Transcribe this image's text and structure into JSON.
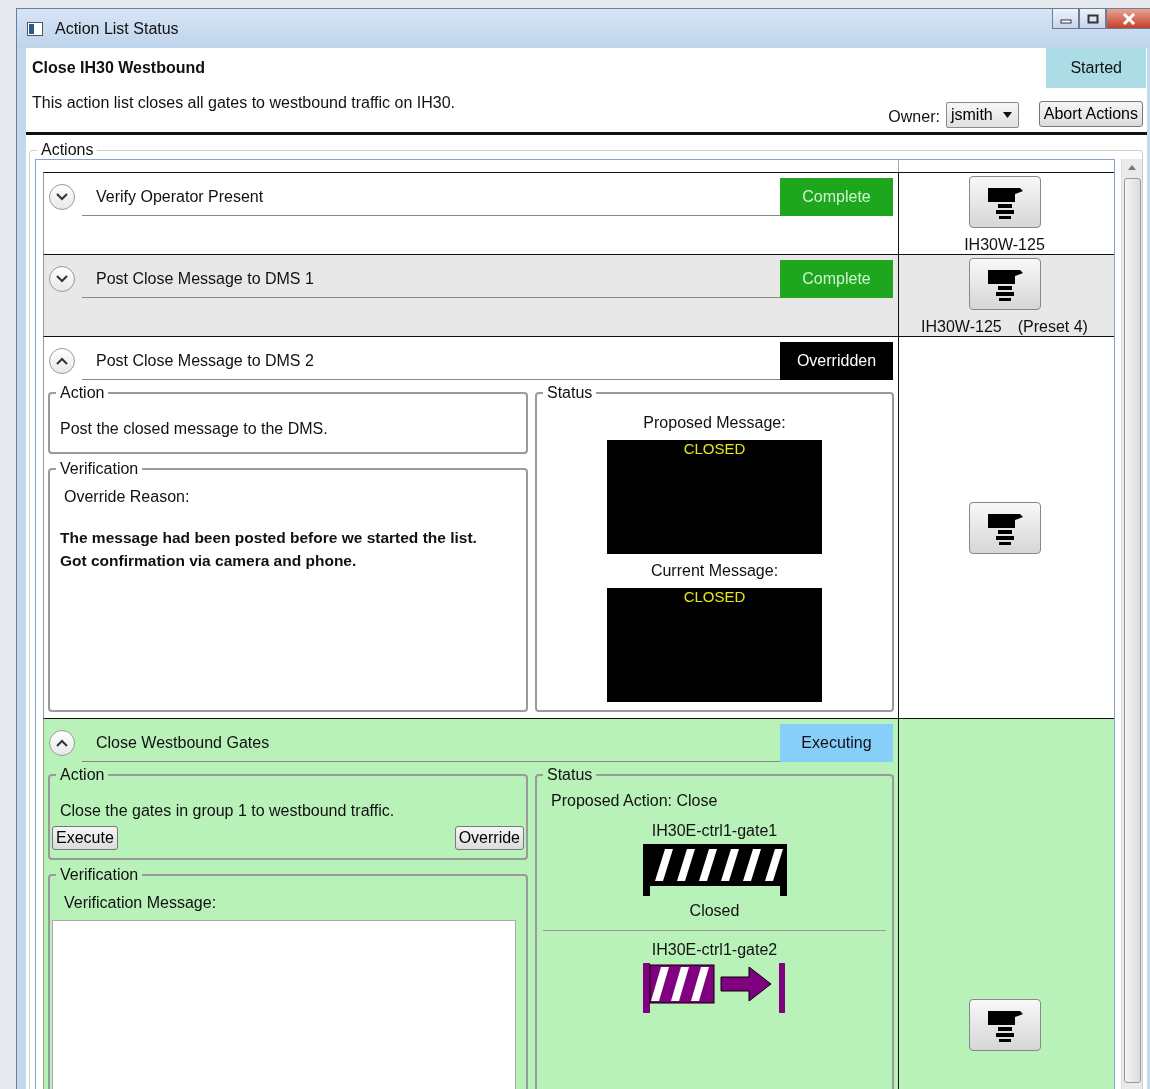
{
  "window": {
    "title": "Action List Status"
  },
  "header": {
    "title": "Close IH30 Westbound",
    "description": "This action list closes all gates to westbound traffic on IH30.",
    "status": "Started",
    "owner_label": "Owner:",
    "owner": "jsmith",
    "abort_button": "Abort Actions"
  },
  "actions_group": {
    "legend": "Actions"
  },
  "actions": [
    {
      "title": "Verify Operator Present",
      "expanded": false,
      "color": "#ffffff",
      "status": {
        "text": "Complete",
        "kind": "complete"
      },
      "camera": {
        "label": "IH30W-125"
      }
    },
    {
      "title": "Post Close Message to DMS 1",
      "expanded": false,
      "color": "#e8e8e8",
      "status": {
        "text": "Complete",
        "kind": "complete"
      },
      "camera": {
        "label": "IH30W-125",
        "preset": "(Preset 4)"
      }
    },
    {
      "title": "Post Close Message to DMS 2",
      "expanded": true,
      "color": "#ffffff",
      "status": {
        "text": "Overridden",
        "kind": "overridden"
      },
      "details": {
        "action": {
          "legend": "Action",
          "text": "Post the closed message to the DMS."
        },
        "verification": {
          "kind": "override_reason",
          "legend": "Verification",
          "label": "Override Reason:",
          "reason": "The message had been posted before we started the list.\nGot confirmation via camera and phone."
        },
        "status": {
          "kind": "dms",
          "legend": "Status",
          "messages": [
            {
              "label": "Proposed Message:",
              "text": "CLOSED"
            },
            {
              "label": "Current Message:",
              "text": "CLOSED"
            }
          ]
        }
      }
    },
    {
      "title": "Close Westbound Gates",
      "expanded": true,
      "color": "#b9f2b9",
      "status": {
        "text": "Executing",
        "kind": "executing"
      },
      "details": {
        "action": {
          "legend": "Action",
          "text": "Close the gates in group 1 to westbound traffic.",
          "buttons": [
            "Execute",
            "Override"
          ]
        },
        "verification": {
          "kind": "message_entry",
          "legend": "Verification",
          "label": "Verification Message:"
        },
        "status": {
          "kind": "gates",
          "legend": "Status",
          "proposed": "Proposed Action: Close",
          "gates": [
            {
              "name": "IH30E-ctrl1-gate1",
              "kind": "closed",
              "state": "Closed"
            },
            {
              "name": "IH30E-ctrl1-gate2",
              "kind": "closing"
            }
          ]
        }
      }
    }
  ]
}
